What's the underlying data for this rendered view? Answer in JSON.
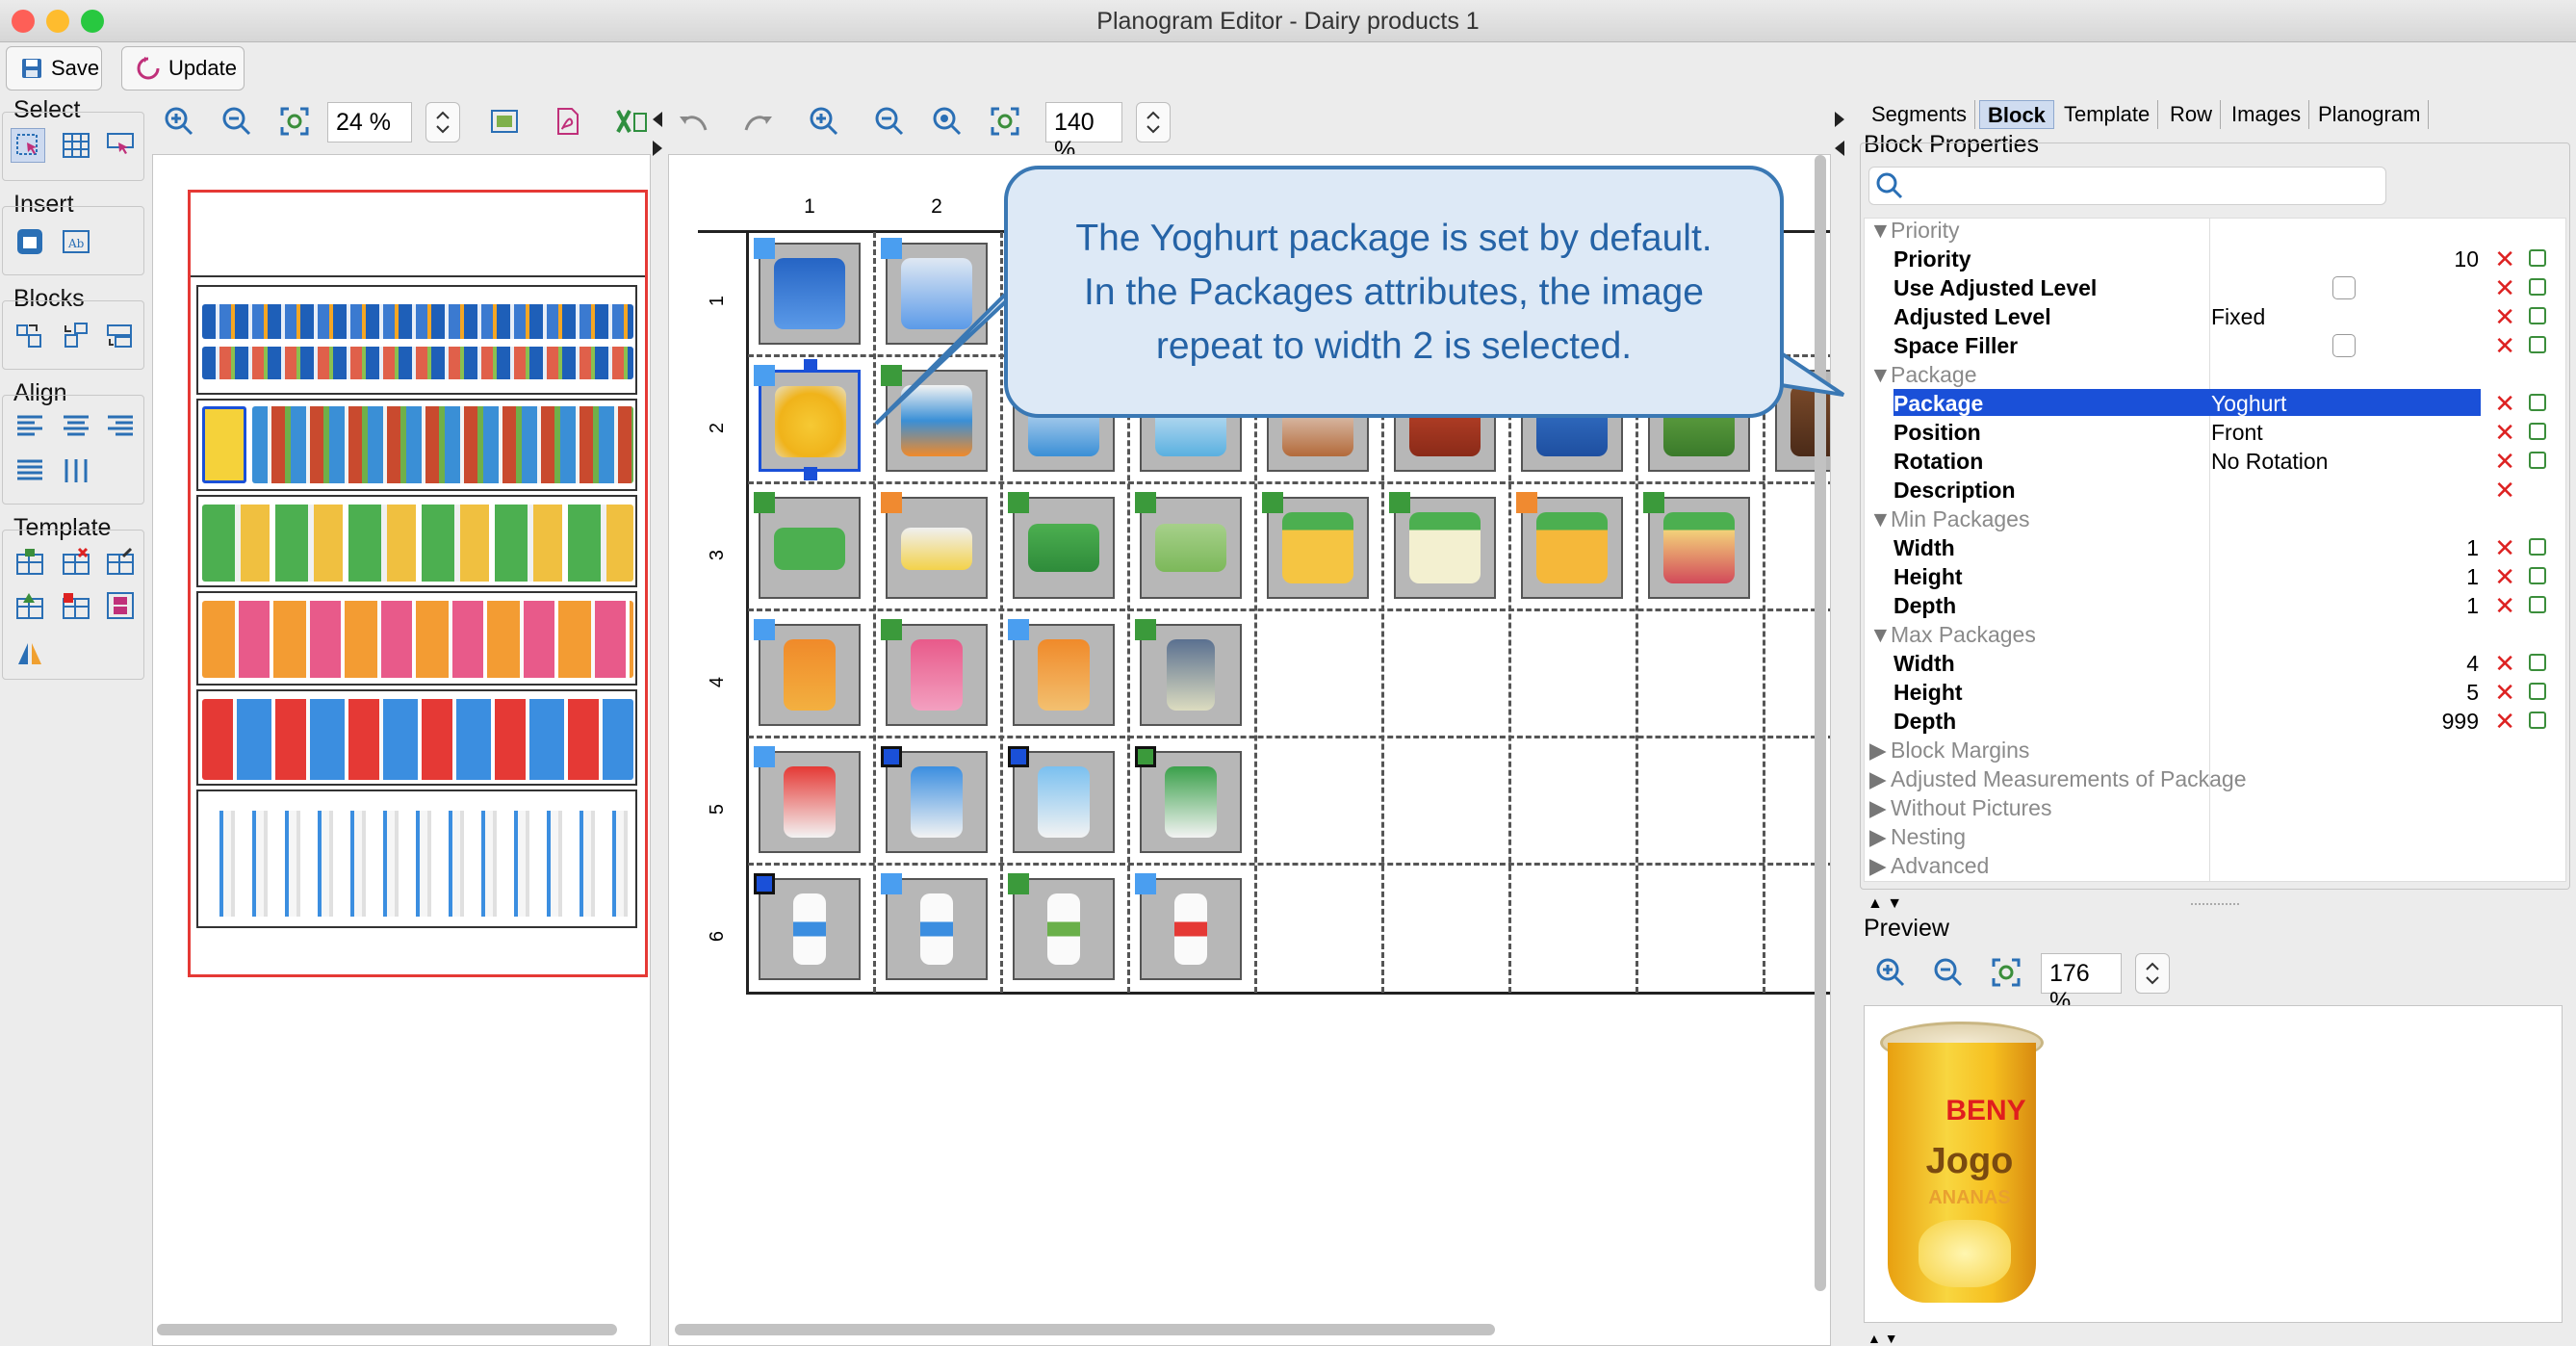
{
  "window": {
    "title": "Planogram Editor - Dairy products 1"
  },
  "toolbar": {
    "save_label": "Save",
    "update_label": "Update"
  },
  "left_tools": {
    "select_label": "Select",
    "insert_label": "Insert",
    "blocks_label": "Blocks",
    "align_label": "Align",
    "template_label": "Template"
  },
  "overview": {
    "zoom": "24 %"
  },
  "canvas": {
    "zoom": "140 %",
    "col_numbers": [
      "1",
      "2"
    ],
    "row_numbers": [
      "1",
      "2",
      "3",
      "4",
      "5",
      "6"
    ]
  },
  "callout": {
    "line1": "The Yoghurt package is set by default.",
    "line2": "In the Packages attributes, the image",
    "line3": "repeat to width 2 is selected."
  },
  "right_panel": {
    "tabs": [
      "Segments",
      "Block",
      "Template",
      "Row",
      "Images",
      "Planogram"
    ],
    "active_tab": "Block",
    "section_title": "Block Properties",
    "groups": {
      "priority": "Priority",
      "package": "Package",
      "min_packages": "Min Packages",
      "max_packages": "Max Packages",
      "block_margins": "Block Margins",
      "adjusted_measurements": "Adjusted Measurements of Package",
      "without_pictures": "Without Pictures",
      "nesting": "Nesting",
      "advanced": "Advanced"
    },
    "rows": {
      "priority": {
        "label": "Priority",
        "value": "10"
      },
      "use_adjusted_level": {
        "label": "Use Adjusted Level"
      },
      "adjusted_level": {
        "label": "Adjusted Level",
        "value": "Fixed"
      },
      "space_filler": {
        "label": "Space Filler"
      },
      "package": {
        "label": "Package",
        "value": "Yoghurt"
      },
      "position": {
        "label": "Position",
        "value": "Front"
      },
      "rotation": {
        "label": "Rotation",
        "value": "No Rotation"
      },
      "description": {
        "label": "Description",
        "value": ""
      },
      "min_width": {
        "label": "Width",
        "value": "1"
      },
      "min_height": {
        "label": "Height",
        "value": "1"
      },
      "min_depth": {
        "label": "Depth",
        "value": "1"
      },
      "max_width": {
        "label": "Width",
        "value": "4"
      },
      "max_height": {
        "label": "Height",
        "value": "5"
      },
      "max_depth": {
        "label": "Depth",
        "value": "999"
      }
    },
    "preview_label": "Preview",
    "preview_zoom": "176 %",
    "preview_product": {
      "brand": "BENY",
      "name": "Jogo",
      "flavor": "ANANAS"
    }
  },
  "colors": {
    "accent_blue": "#3a78b4",
    "selection": "#1a50d8",
    "callout_bg": "#dde9f6"
  }
}
